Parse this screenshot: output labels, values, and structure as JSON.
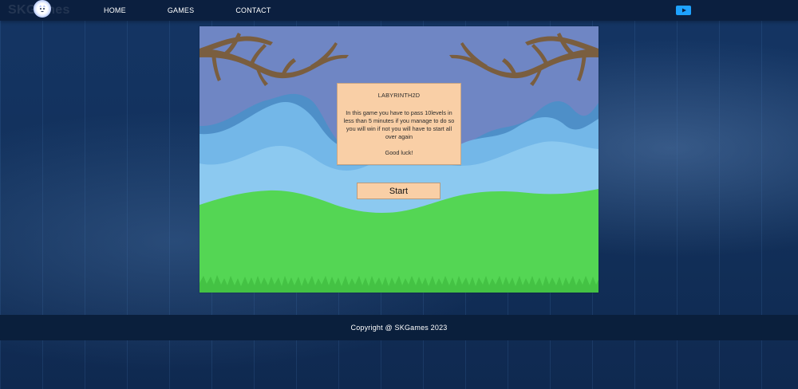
{
  "header": {
    "brand_text": "SKGames",
    "nav": [
      {
        "label": "HOME"
      },
      {
        "label": "GAMES"
      },
      {
        "label": "CONTACT"
      }
    ],
    "social_icon": "youtube-icon"
  },
  "game": {
    "info": {
      "title": "LABYRINTH2D",
      "body": "In this game you have to pass 10levels in less than 5 minutes if you manage to do so you will win if not you will have to start all over again",
      "closing": "Good luck!"
    },
    "start_label": "Start"
  },
  "footer": {
    "copyright": "Copyright @ SKGames 2023"
  },
  "colors": {
    "header_bg": "#0b1f3f",
    "page_bg": "#123058",
    "panel_bg": "#f9cfa6",
    "grass": "#54d654",
    "sky": "#6f86c4",
    "accent_youtube": "#1ea2ff"
  }
}
